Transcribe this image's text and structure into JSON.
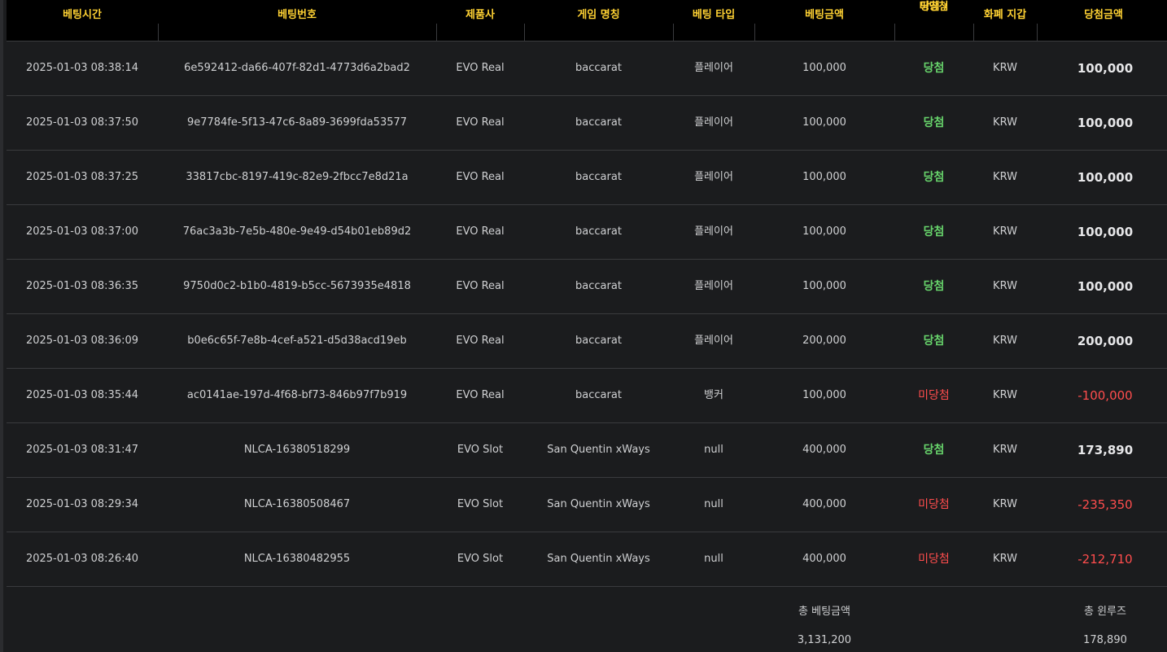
{
  "columns": {
    "bet_time": "베팅시간",
    "bet_id": "베팅번호",
    "provider": "제품사",
    "game_name": "게임 명칭",
    "bet_type": "베팅 타입",
    "bet_amount": "베팅금액",
    "result_line1": "당첨 /",
    "result_line2": "미당첨",
    "currency": "화폐 지갑",
    "payout": "당첨금액"
  },
  "rows": [
    {
      "time": "2025-01-03 08:38:14",
      "id": "6e592412-da66-407f-82d1-4773d6a2bad2",
      "provider": "EVO Real",
      "game": "baccarat",
      "type": "플레이어",
      "amount": "100,000",
      "result": "당첨",
      "currency": "KRW",
      "payout": "100,000"
    },
    {
      "time": "2025-01-03 08:37:50",
      "id": "9e7784fe-5f13-47c6-8a89-3699fda53577",
      "provider": "EVO Real",
      "game": "baccarat",
      "type": "플레이어",
      "amount": "100,000",
      "result": "당첨",
      "currency": "KRW",
      "payout": "100,000"
    },
    {
      "time": "2025-01-03 08:37:25",
      "id": "33817cbc-8197-419c-82e9-2fbcc7e8d21a",
      "provider": "EVO Real",
      "game": "baccarat",
      "type": "플레이어",
      "amount": "100,000",
      "result": "당첨",
      "currency": "KRW",
      "payout": "100,000"
    },
    {
      "time": "2025-01-03 08:37:00",
      "id": "76ac3a3b-7e5b-480e-9e49-d54b01eb89d2",
      "provider": "EVO Real",
      "game": "baccarat",
      "type": "플레이어",
      "amount": "100,000",
      "result": "당첨",
      "currency": "KRW",
      "payout": "100,000"
    },
    {
      "time": "2025-01-03 08:36:35",
      "id": "9750d0c2-b1b0-4819-b5cc-5673935e4818",
      "provider": "EVO Real",
      "game": "baccarat",
      "type": "플레이어",
      "amount": "100,000",
      "result": "당첨",
      "currency": "KRW",
      "payout": "100,000"
    },
    {
      "time": "2025-01-03 08:36:09",
      "id": "b0e6c65f-7e8b-4cef-a521-d5d38acd19eb",
      "provider": "EVO Real",
      "game": "baccarat",
      "type": "플레이어",
      "amount": "200,000",
      "result": "당첨",
      "currency": "KRW",
      "payout": "200,000"
    },
    {
      "time": "2025-01-03 08:35:44",
      "id": "ac0141ae-197d-4f68-bf73-846b97f7b919",
      "provider": "EVO Real",
      "game": "baccarat",
      "type": "뱅커",
      "amount": "100,000",
      "result": "미당첨",
      "currency": "KRW",
      "payout": "-100,000"
    },
    {
      "time": "2025-01-03 08:31:47",
      "id": "NLCA-16380518299",
      "provider": "EVO Slot",
      "game": "San Quentin xWays",
      "type": "null",
      "amount": "400,000",
      "result": "당첨",
      "currency": "KRW",
      "payout": "173,890"
    },
    {
      "time": "2025-01-03 08:29:34",
      "id": "NLCA-16380508467",
      "provider": "EVO Slot",
      "game": "San Quentin xWays",
      "type": "null",
      "amount": "400,000",
      "result": "미당첨",
      "currency": "KRW",
      "payout": "-235,350"
    },
    {
      "time": "2025-01-03 08:26:40",
      "id": "NLCA-16380482955",
      "provider": "EVO Slot",
      "game": "San Quentin xWays",
      "type": "null",
      "amount": "400,000",
      "result": "미당첨",
      "currency": "KRW",
      "payout": "-212,710"
    }
  ],
  "summary": {
    "total_bet_label": "총 베팅금액",
    "total_bet_value": "3,131,200",
    "total_winloss_label": "총 윈루즈",
    "total_winloss_value": "178,890"
  },
  "colors": {
    "header_text": "#ffd233",
    "win": "#67d36b",
    "lose": "#ff4d4d",
    "background": "#1b1c1e"
  }
}
